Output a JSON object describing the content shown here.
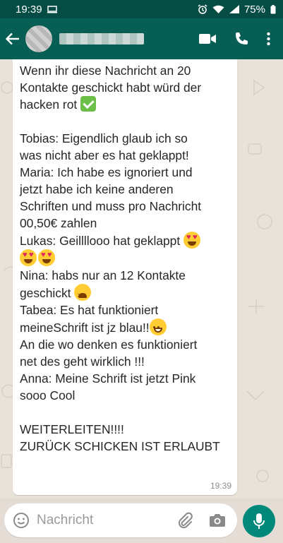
{
  "status_bar": {
    "time": "19:39",
    "battery": "75%"
  },
  "header": {
    "icons": [
      "back-arrow-icon",
      "video-call-icon",
      "phone-icon",
      "more-vert-icon"
    ]
  },
  "message": {
    "lines": [
      "Wenn ihr diese Nachricht an 20",
      "Kontakte geschickt habt würd der",
      "hacken rot",
      "",
      "Tobias: Eigendlich glaub ich so",
      "was nicht aber es hat geklappt!",
      "Maria: Ich habe es ignoriert und",
      "jetzt habe ich keine anderen",
      "Schriften und muss pro Nachricht",
      "00,50€ zahlen",
      "Lukas: Geillllooo hat geklappt",
      "",
      "Nina: habs nur an 12 Kontakte",
      "geschickt",
      "Tabea: Es hat funktioniert",
      "meineSchrift ist jz blau!!",
      "An die wo denken es funktioniert",
      "net des geht wirklich !!!",
      "Anna: Meine Schrift ist jetzt Pink",
      "sooo Cool",
      "",
      "WEITERLEITEN!!!!",
      "ZURÜCK SCHICKEN IST ERLAUBT"
    ],
    "time": "19:39"
  },
  "composer": {
    "placeholder": "Nachricht"
  },
  "colors": {
    "status_bar": "#054d44",
    "app_bar": "#075e54",
    "mic_button": "#00897b",
    "chat_background": "#e9e2d9"
  }
}
